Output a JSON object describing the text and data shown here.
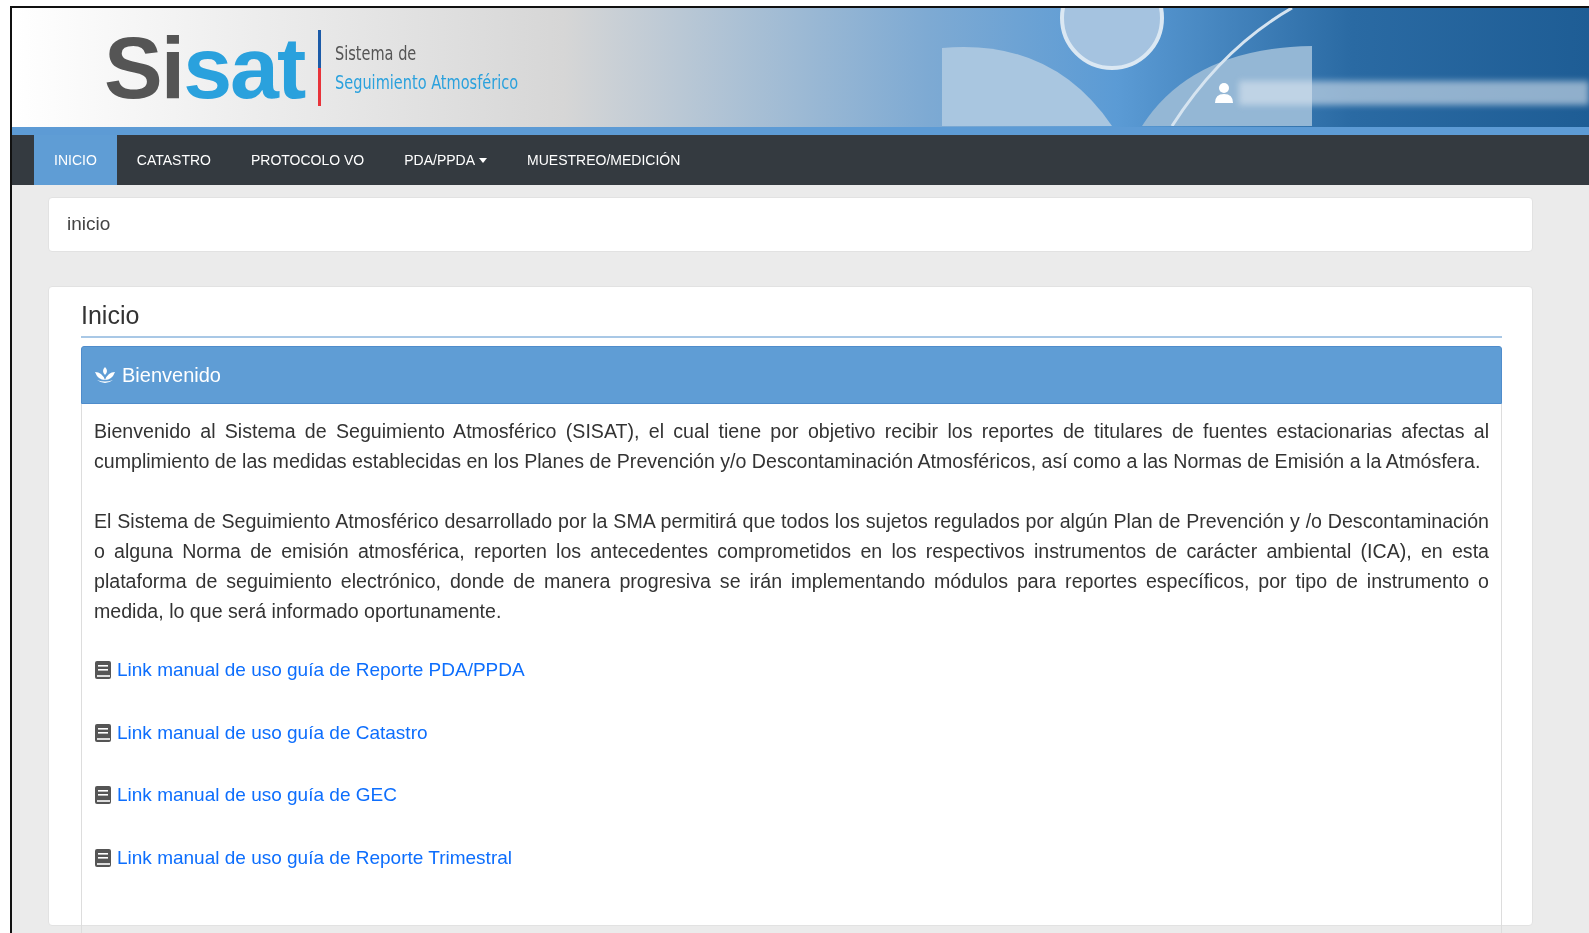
{
  "header": {
    "logo": {
      "dark": "Si",
      "light": "sat"
    },
    "tagline_top": "Sistema de",
    "tagline_bottom": "Seguimiento Atmosférico"
  },
  "nav": [
    {
      "label": "INICIO",
      "selected": true,
      "dropdown": false
    },
    {
      "label": "CATASTRO",
      "selected": false,
      "dropdown": false
    },
    {
      "label": "PROTOCOLO VO",
      "selected": false,
      "dropdown": false
    },
    {
      "label": "PDA/PPDA",
      "selected": false,
      "dropdown": true
    },
    {
      "label": "MUESTREO/MEDICIÓN",
      "selected": false,
      "dropdown": false
    }
  ],
  "breadcrumb": "inicio",
  "page_title": "Inicio",
  "panel": {
    "title": "Bienvenido",
    "paragraphs": [
      "Bienvenido al Sistema de Seguimiento Atmosférico (SISAT), el cual tiene por objetivo recibir los reportes de titulares de fuentes estacionarias afectas al cumplimiento de las medidas establecidas en los Planes de Prevención y/o Descontaminación Atmosféricos, así como a las Normas de Emisión a la Atmósfera.",
      "El Sistema de Seguimiento Atmosférico desarrollado por la SMA permitirá que todos los sujetos regulados por algún Plan de Prevención y /o Descontaminación o alguna Norma de emisión atmosférica, reporten los antecedentes comprometidos en los respectivos instrumentos de carácter ambiental (ICA), en esta plataforma de seguimiento electrónico, donde de manera progresiva se irán implementando módulos para reportes específicos, por tipo de instrumento o medida, lo que será informado oportunamente."
    ],
    "links": [
      "Link manual de uso guía de Reporte PDA/PPDA",
      "Link manual de uso guía de Catastro",
      "Link manual de uso guía de GEC",
      "Link manual de uso guía de Reporte Trimestral"
    ]
  }
}
